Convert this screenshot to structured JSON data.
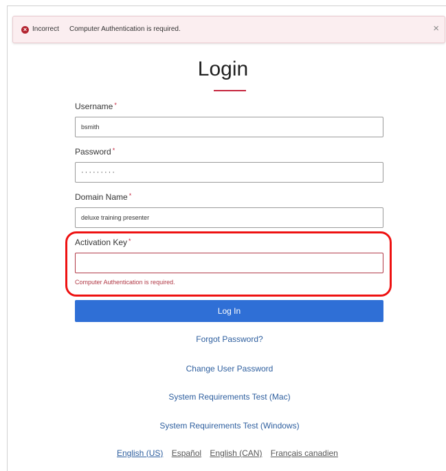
{
  "alert": {
    "title": "Incorrect",
    "message": "Computer Authentication is required.",
    "close": "×",
    "icon": "error-circle-icon"
  },
  "page_title": "Login",
  "fields": {
    "username": {
      "label": "Username",
      "value": "bsmith"
    },
    "password": {
      "label": "Password",
      "value": "·········"
    },
    "domain": {
      "label": "Domain Name",
      "value": "deluxe training presenter"
    },
    "activation": {
      "label": "Activation Key",
      "value": "",
      "error": "Computer Authentication is required."
    }
  },
  "required_marker": "*",
  "login_button": "Log In",
  "links": {
    "forgot": "Forgot Password?",
    "change": "Change User Password",
    "sys_mac": "System Requirements Test (Mac)",
    "sys_win": "System Requirements Test (Windows)"
  },
  "languages": [
    "English (US)",
    "Español",
    "English (CAN)",
    "Français canadien"
  ],
  "colors": {
    "accent": "#c5223b",
    "button": "#2f6fd6",
    "link": "#2d5e9e",
    "highlight": "#ee1111"
  }
}
